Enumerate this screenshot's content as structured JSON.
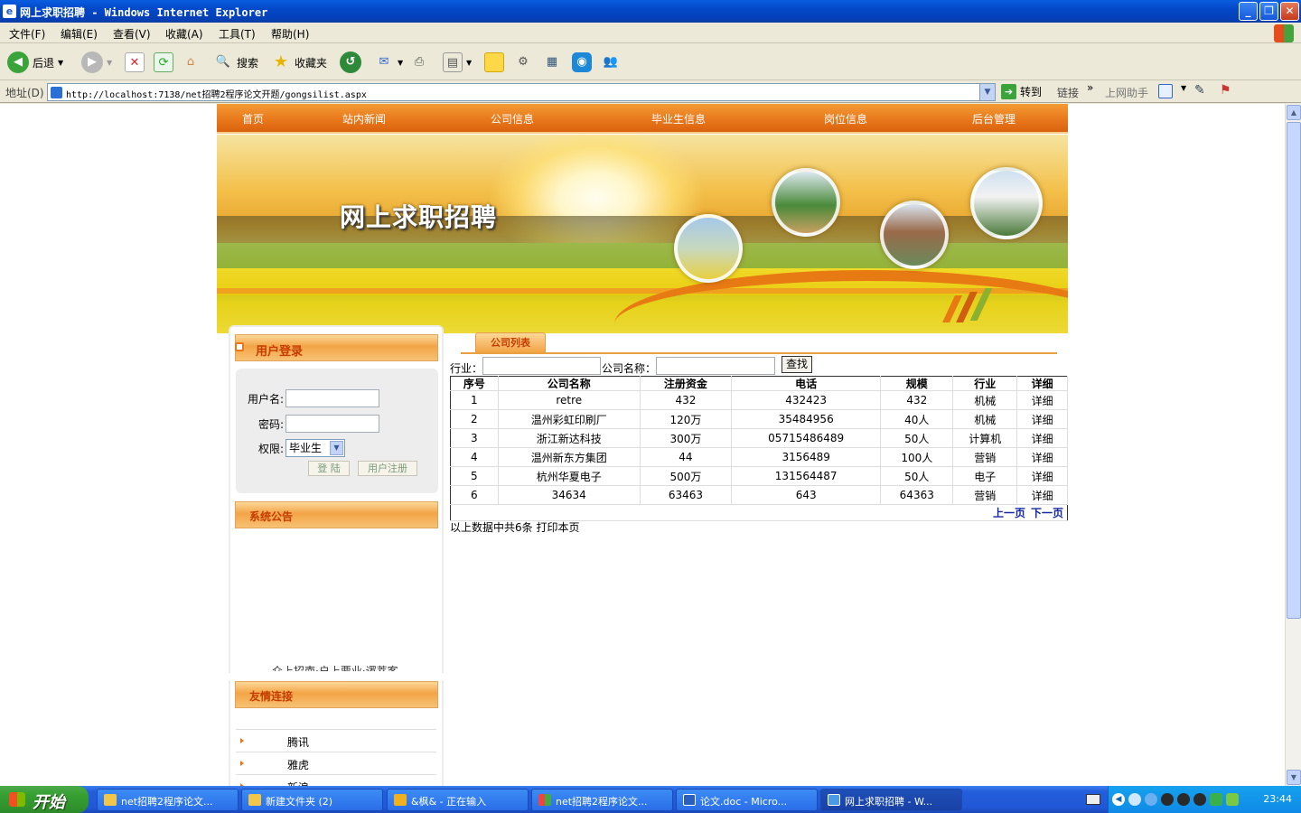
{
  "window": {
    "title": "网上求职招聘 - Windows Internet Explorer"
  },
  "menu": [
    "文件(F)",
    "编辑(E)",
    "查看(V)",
    "收藏(A)",
    "工具(T)",
    "帮助(H)"
  ],
  "toolbar": {
    "back": "后退",
    "search": "搜索",
    "favorites": "收藏夹"
  },
  "address": {
    "label": "地址(D)",
    "url": "http://localhost:7138/net招聘2程序论文开题/gongsilist.aspx",
    "go": "转到",
    "links": "链接",
    "helper": "上网助手"
  },
  "nav": [
    "首页",
    "站内新闻",
    "公司信息",
    "毕业生信息",
    "岗位信息",
    "后台管理"
  ],
  "banner": {
    "title": "网上求职招聘"
  },
  "login": {
    "header": "用户登录",
    "username_label": "用户名:",
    "password_label": "密码:",
    "role_label": "权限:",
    "role_value": "毕业生",
    "login_btn": "登 陆",
    "register_btn": "用户注册"
  },
  "notice": {
    "header": "系统公告",
    "text": "众上招南·户上要业·逻萃客"
  },
  "links": {
    "header": "友情连接",
    "items": [
      "腾讯",
      "雅虎",
      "新浪"
    ]
  },
  "list": {
    "tab": "公司列表",
    "industry_label": "行业：",
    "company_label": "公司名称：",
    "search_btn": "查找",
    "columns": [
      "序号",
      "公司名称",
      "注册资金",
      "电话",
      "规模",
      "行业",
      "详细"
    ],
    "rows": [
      [
        "1",
        "retre",
        "432",
        "432423",
        "432",
        "机械",
        "详细"
      ],
      [
        "2",
        "温州彩虹印刷厂",
        "120万",
        "35484956",
        "40人",
        "机械",
        "详细"
      ],
      [
        "3",
        "浙江新达科技",
        "300万",
        "05715486489",
        "50人",
        "计算机",
        "详细"
      ],
      [
        "4",
        "温州新东方集团",
        "44",
        "3156489",
        "100人",
        "营销",
        "详细"
      ],
      [
        "5",
        "杭州华夏电子",
        "500万",
        "131564487",
        "50人",
        "电子",
        "详细"
      ],
      [
        "6",
        "34634",
        "63463",
        "643",
        "64363",
        "营销",
        "详细"
      ]
    ],
    "prev": "上一页",
    "next": "下一页",
    "footer": "以上数据中共6条  打印本页"
  },
  "taskbar": {
    "start": "开始",
    "tasks": [
      "net招聘2程序论文...",
      "新建文件夹 (2)",
      "&枫& - 正在输入",
      "net招聘2程序论文...",
      "论文.doc - Micro...",
      "网上求职招聘 - W..."
    ],
    "clock": "23:44"
  }
}
